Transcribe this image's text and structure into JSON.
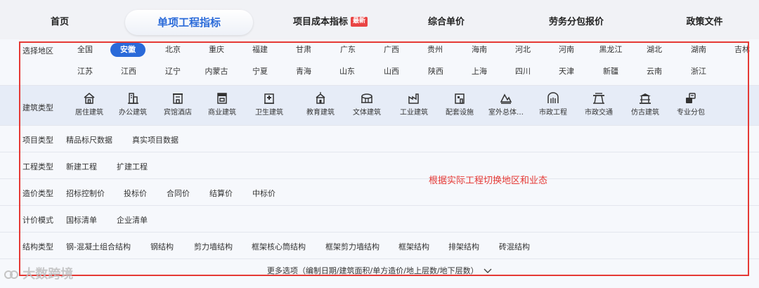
{
  "tabs": [
    {
      "label": "首页"
    },
    {
      "label": "单项工程指标"
    },
    {
      "label": "项目成本指标",
      "badge": "最新"
    },
    {
      "label": "综合单价"
    },
    {
      "label": "劳务分包报价"
    },
    {
      "label": "政策文件"
    }
  ],
  "filters": {
    "region": {
      "label": "选择地区",
      "row1": [
        "全国",
        "安徽",
        "北京",
        "重庆",
        "福建",
        "甘肃",
        "广东",
        "广西",
        "贵州",
        "海南",
        "河北",
        "河南",
        "黑龙江",
        "湖北",
        "湖南",
        "吉林"
      ],
      "row2": [
        "江苏",
        "江西",
        "辽宁",
        "内蒙古",
        "宁夏",
        "青海",
        "山东",
        "山西",
        "陕西",
        "上海",
        "四川",
        "天津",
        "新疆",
        "云南",
        "浙江"
      ],
      "selected": "安徽"
    },
    "building_type": {
      "label": "建筑类型",
      "items": [
        {
          "label": "居住建筑",
          "icon": "house-icon"
        },
        {
          "label": "办公建筑",
          "icon": "office-icon"
        },
        {
          "label": "宾馆酒店",
          "icon": "hotel-icon"
        },
        {
          "label": "商业建筑",
          "icon": "store-icon"
        },
        {
          "label": "卫生建筑",
          "icon": "hospital-icon"
        },
        {
          "label": "教育建筑",
          "icon": "school-icon"
        },
        {
          "label": "文体建筑",
          "icon": "stadium-icon"
        },
        {
          "label": "工业建筑",
          "icon": "factory-icon"
        },
        {
          "label": "配套设施",
          "icon": "facility-icon"
        },
        {
          "label": "室外总体…",
          "icon": "outdoor-icon"
        },
        {
          "label": "市政工程",
          "icon": "municipal-icon"
        },
        {
          "label": "市政交通",
          "icon": "transport-icon"
        },
        {
          "label": "仿古建筑",
          "icon": "pavilion-icon"
        },
        {
          "label": "专业分包",
          "icon": "subcontract-icon"
        }
      ]
    },
    "project_type": {
      "label": "项目类型",
      "options": [
        "精品标尺数据",
        "真实项目数据"
      ]
    },
    "engineering_type": {
      "label": "工程类型",
      "options": [
        "新建工程",
        "扩建工程"
      ]
    },
    "cost_type": {
      "label": "造价类型",
      "options": [
        "招标控制价",
        "投标价",
        "合同价",
        "结算价",
        "中标价"
      ]
    },
    "pricing_mode": {
      "label": "计价模式",
      "options": [
        "国标清单",
        "企业清单"
      ]
    },
    "structure_type": {
      "label": "结构类型",
      "options": [
        "钢-混凝土组合结构",
        "钢结构",
        "剪力墙结构",
        "框架核心筒结构",
        "框架剪力墙结构",
        "框架结构",
        "排架结构",
        "砖混结构"
      ]
    }
  },
  "more_options": "更多选项（编制日期/建筑面积/单方造价/地上层数/地下层数）",
  "annotation": "根据实际工程切换地区和业态",
  "watermark": "大数跨境",
  "colors": {
    "accent": "#2a6ad9",
    "annotation": "#e53935",
    "badge": "#e94444"
  }
}
